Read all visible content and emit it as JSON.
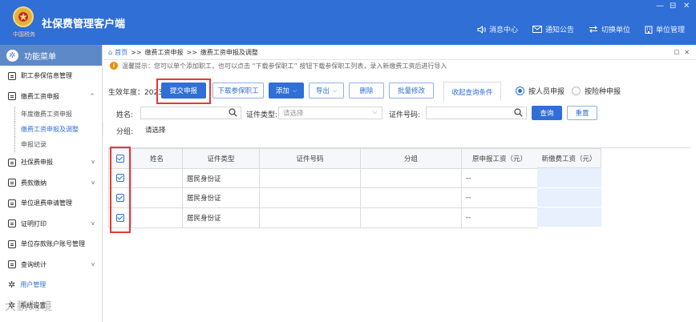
{
  "app": {
    "title": "社保费管理客户端",
    "logo_caption": "中国税务",
    "window_controls": [
      "—",
      "⊟",
      "✕"
    ],
    "top_links": [
      {
        "label": "消息中心",
        "icon": "speaker-icon"
      },
      {
        "label": "通知公告",
        "icon": "mail-icon"
      },
      {
        "label": "切换单位",
        "icon": "switch-icon"
      },
      {
        "label": "单位管理",
        "icon": "building-icon"
      }
    ]
  },
  "sidebar": {
    "header": "功能菜单",
    "items": [
      {
        "label": "职工参保信息管理"
      },
      {
        "label": "缴费工资申报",
        "expanded": true,
        "chevron": "^"
      },
      {
        "label": "社保费申报",
        "chevron": "v"
      },
      {
        "label": "费款缴纳",
        "chevron": "v"
      },
      {
        "label": "单位退费申请管理"
      },
      {
        "label": "证明打印",
        "chevron": "v"
      },
      {
        "label": "单位存款账户账号管理"
      },
      {
        "label": "查询统计",
        "chevron": "v"
      },
      {
        "label": "用户管理"
      },
      {
        "label": "系统设置"
      }
    ],
    "subitems": [
      {
        "label": "年度缴费工资申报"
      },
      {
        "label": "缴费工资申报及调整",
        "selected": true
      },
      {
        "label": "申报记录"
      }
    ],
    "watermark": "大鹏跨境"
  },
  "breadcrumb": {
    "home": "首页",
    "sep": ">>",
    "level1": "缴费工资申报",
    "level2": "缴费工资申报及调整",
    "right_dot": "□",
    "close": "✕"
  },
  "tip": {
    "icon": "i",
    "text": "温馨提示：您可以单个添加职工，也可以点击 “下载参保职工” 按钮下载参保职工列表，录入新缴费工资后进行导入"
  },
  "toolbar": {
    "year_label": "生效年度：2023",
    "submit": "提交申报",
    "download": "下载参保职工",
    "add": "添加",
    "export": "导出",
    "delete": "删除",
    "batch_edit": "批量修改",
    "collapse": "收起查询条件",
    "radio_person": "按人员申报",
    "radio_insurance": "按险种申报"
  },
  "filters": {
    "name_label": "姓名:",
    "cert_type_label": "证件类型:",
    "cert_type_placeholder": "请选择",
    "cert_no_label": "证件号码:",
    "group_label": "分组:",
    "group_placeholder": "请选择",
    "query": "查询",
    "reset": "重置"
  },
  "table": {
    "headers": [
      "姓名",
      "证件类型",
      "证件号码",
      "分组",
      "原申报工资（元）",
      "新缴费工资（元）"
    ],
    "rows": [
      {
        "name": "",
        "cert_type": "居民身份证",
        "cert_no": "",
        "group": "",
        "orig_wage": "--"
      },
      {
        "name": "",
        "cert_type": "居民身份证",
        "cert_no": "",
        "group": "",
        "orig_wage": "--"
      },
      {
        "name": "",
        "cert_type": "居民身份证",
        "cert_no": "",
        "group": "",
        "orig_wage": "--"
      }
    ]
  },
  "colors": {
    "brand_blue": "#2f6fd6",
    "sidebar_header": "#5e89c8",
    "highlight_red": "#e53935",
    "warning_orange": "#f08c00"
  }
}
